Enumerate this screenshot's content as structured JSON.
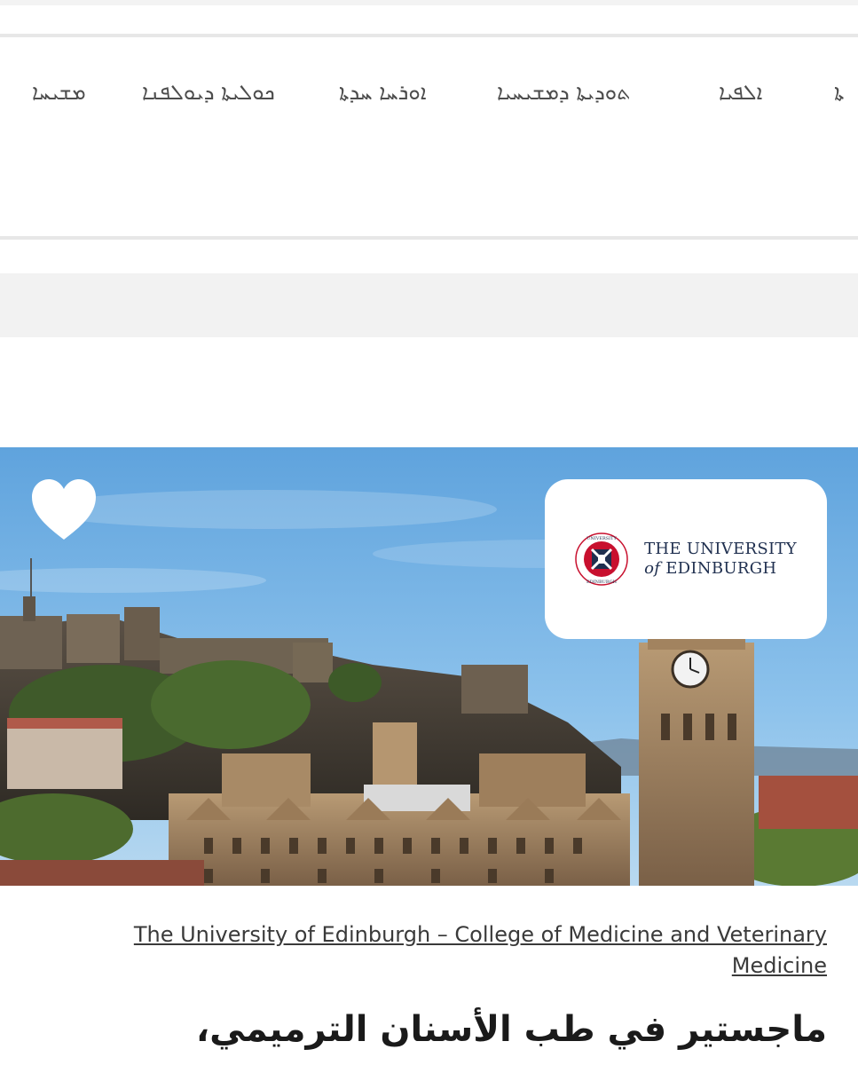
{
  "nav": {
    "items": [
      {
        "label": "ܡܫܝܚܐ"
      },
      {
        "label": "ܟܘܠܝܬܐ ܕܝܘܠܦܢܐ"
      },
      {
        "label": "ܐܘܪܚܐ ܚܕܬܐ"
      },
      {
        "label": "ܬܘܕܝܬܐ ܕܡܫܝܚܝܐ"
      },
      {
        "label": "ܐܠܦܝܐ"
      },
      {
        "label": "ܬܐ"
      }
    ]
  },
  "hero": {
    "favorite_icon": "heart-icon",
    "logo": {
      "line1": "THE UNIVERSITY",
      "line2_prefix": "of",
      "line2_rest": "EDINBURGH",
      "seal_text": "THE UNIVERSITY OF EDINBURGH"
    }
  },
  "listing": {
    "provider": "The University of Edinburgh – College of Medicine and Veterinary Medicine",
    "title": "ماجستير في طب الأسنان الترميمي،"
  },
  "colors": {
    "heart": "#ffffff",
    "logo_navy": "#1f2f4f",
    "logo_red": "#c8102e",
    "sky": "#7fb6e6"
  }
}
